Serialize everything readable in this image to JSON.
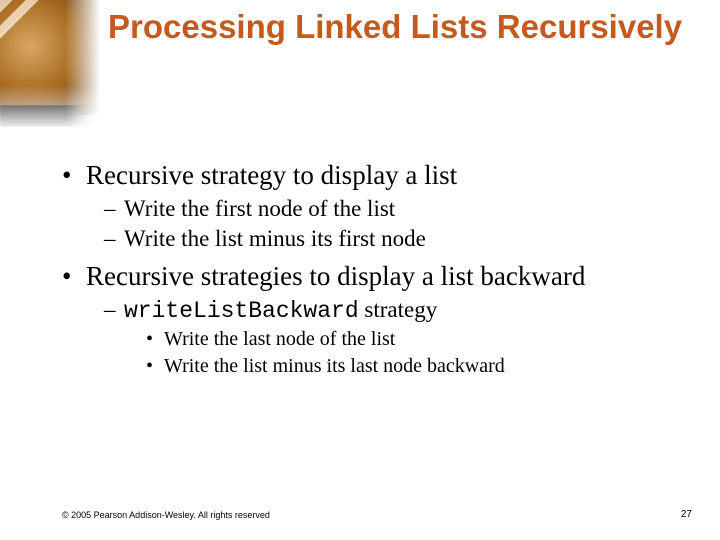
{
  "title": "Processing Linked Lists Recursively",
  "bullets": {
    "b1": "Recursive strategy to display a list",
    "b1a": "Write the first node of the list",
    "b1b": "Write the list minus its first node",
    "b2": "Recursive strategies to display a list backward",
    "b2a_code": "writeListBackward",
    "b2a_rest": " strategy",
    "b2a1": "Write the last node of the list",
    "b2a2": "Write the list minus its last node backward"
  },
  "footer": "© 2005 Pearson Addison-Wesley. All rights reserved",
  "pagenum": "27"
}
